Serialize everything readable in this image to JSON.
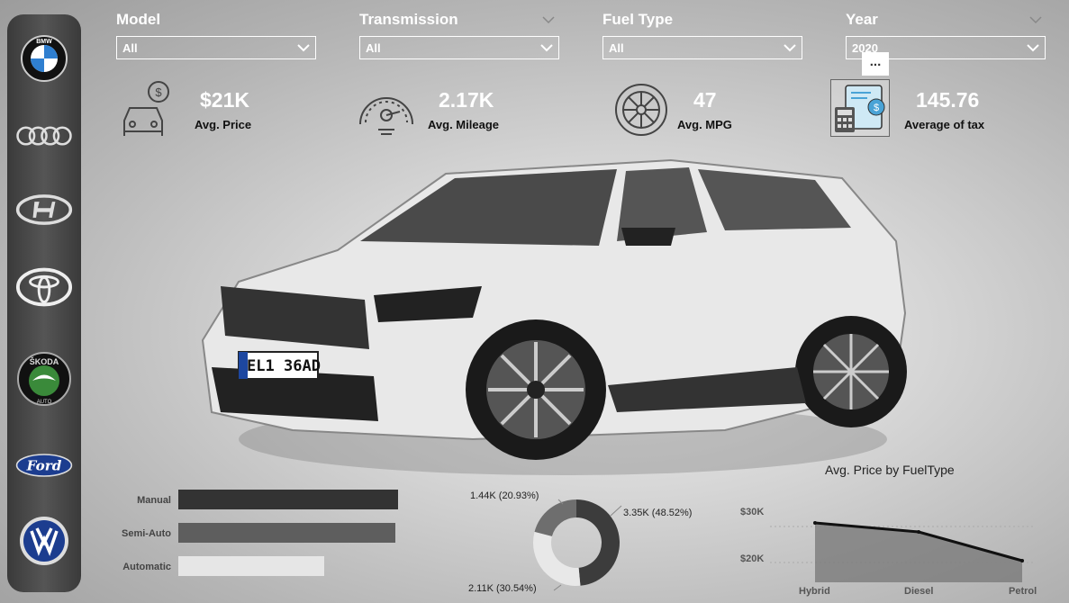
{
  "slicers": [
    {
      "label": "Model",
      "value": "All"
    },
    {
      "label": "Transmission",
      "value": "All"
    },
    {
      "label": "Fuel Type",
      "value": "All"
    },
    {
      "label": "Year",
      "value": "2020"
    }
  ],
  "more_options": "...",
  "kpis": [
    {
      "value": "$21K",
      "caption": "Avg. Price",
      "icon": "car-price-icon"
    },
    {
      "value": "2.17K",
      "caption": "Avg. Mileage",
      "icon": "speedometer-icon"
    },
    {
      "value": "47",
      "caption": "Avg. MPG",
      "icon": "wheel-icon"
    },
    {
      "value": "145.76",
      "caption": "Average of tax",
      "icon": "tax-calculator-icon"
    }
  ],
  "brands": [
    "BMW",
    "Audi",
    "Hyundai",
    "Toyota",
    "Skoda",
    "Ford",
    "Volkswagen"
  ],
  "plate": "EL1 36AD",
  "colors": {
    "accent": "#ffffff",
    "dark": "#333333",
    "mid": "#5e5e5e",
    "light": "#e6e6e6"
  },
  "chart_data": [
    {
      "type": "bar",
      "categories": [
        "Manual",
        "Semi-Auto",
        "Automatic"
      ],
      "values": [
        0.93,
        0.92,
        0.62
      ]
    },
    {
      "type": "pie",
      "data_labels": [
        "3.35K (48.52%)",
        "2.11K (30.54%)",
        "1.44K (20.93%)"
      ],
      "values": [
        48.52,
        30.54,
        20.93
      ]
    },
    {
      "type": "area",
      "title": "Avg. Price by FuelType",
      "categories": [
        "Hybrid",
        "Diesel",
        "Petrol"
      ],
      "values": [
        31000,
        28500,
        20500
      ],
      "yticks": [
        "$30K",
        "$20K"
      ],
      "ylim": [
        15000,
        32000
      ]
    }
  ]
}
